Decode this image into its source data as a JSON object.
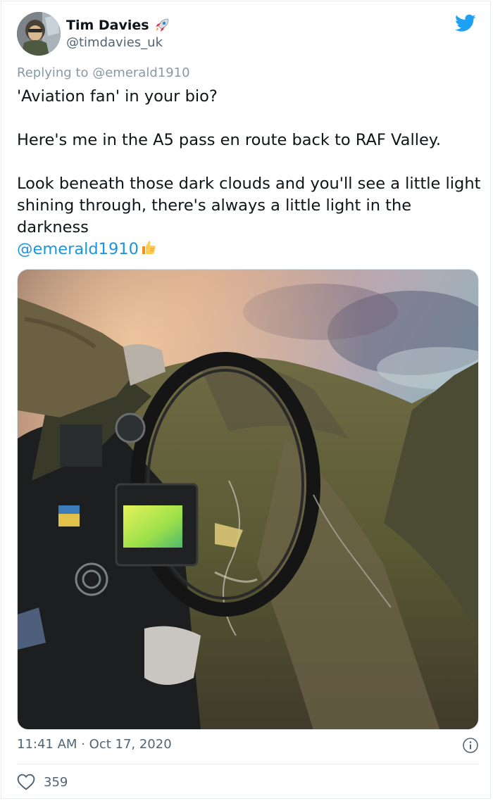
{
  "author": {
    "name": "Tim Davies",
    "handle": "@timdavies_uk",
    "name_emoji_icon": "rocket-icon",
    "avatar": "avatar-photo"
  },
  "platform_icon": "twitter-bird-icon",
  "reply": {
    "prefix": "Replying to",
    "mention": "@emerald1910"
  },
  "tweet": {
    "line1": "'Aviation fan' in your bio?",
    "line2": "Here's me in the A5 pass en route back to RAF Valley.",
    "line3": "Look beneath those dark clouds and you'll see a little light shining through, there's always a little light in the darkness",
    "mention": "@emerald1910",
    "end_emoji_icon": "thumbs-up-icon"
  },
  "media": {
    "type": "photo",
    "subject": "cockpit-view-over-mountain-pass"
  },
  "meta": {
    "time": "11:41 AM",
    "separator": "·",
    "date": "Oct 17, 2020",
    "info_icon": "info-icon"
  },
  "engagement": {
    "like_icon": "heart-icon",
    "likes": "359"
  },
  "colors": {
    "link": "#1b95e0",
    "twitter_blue": "#1da1f2",
    "secondary_text": "#536471",
    "divider": "#e6ecf0"
  }
}
